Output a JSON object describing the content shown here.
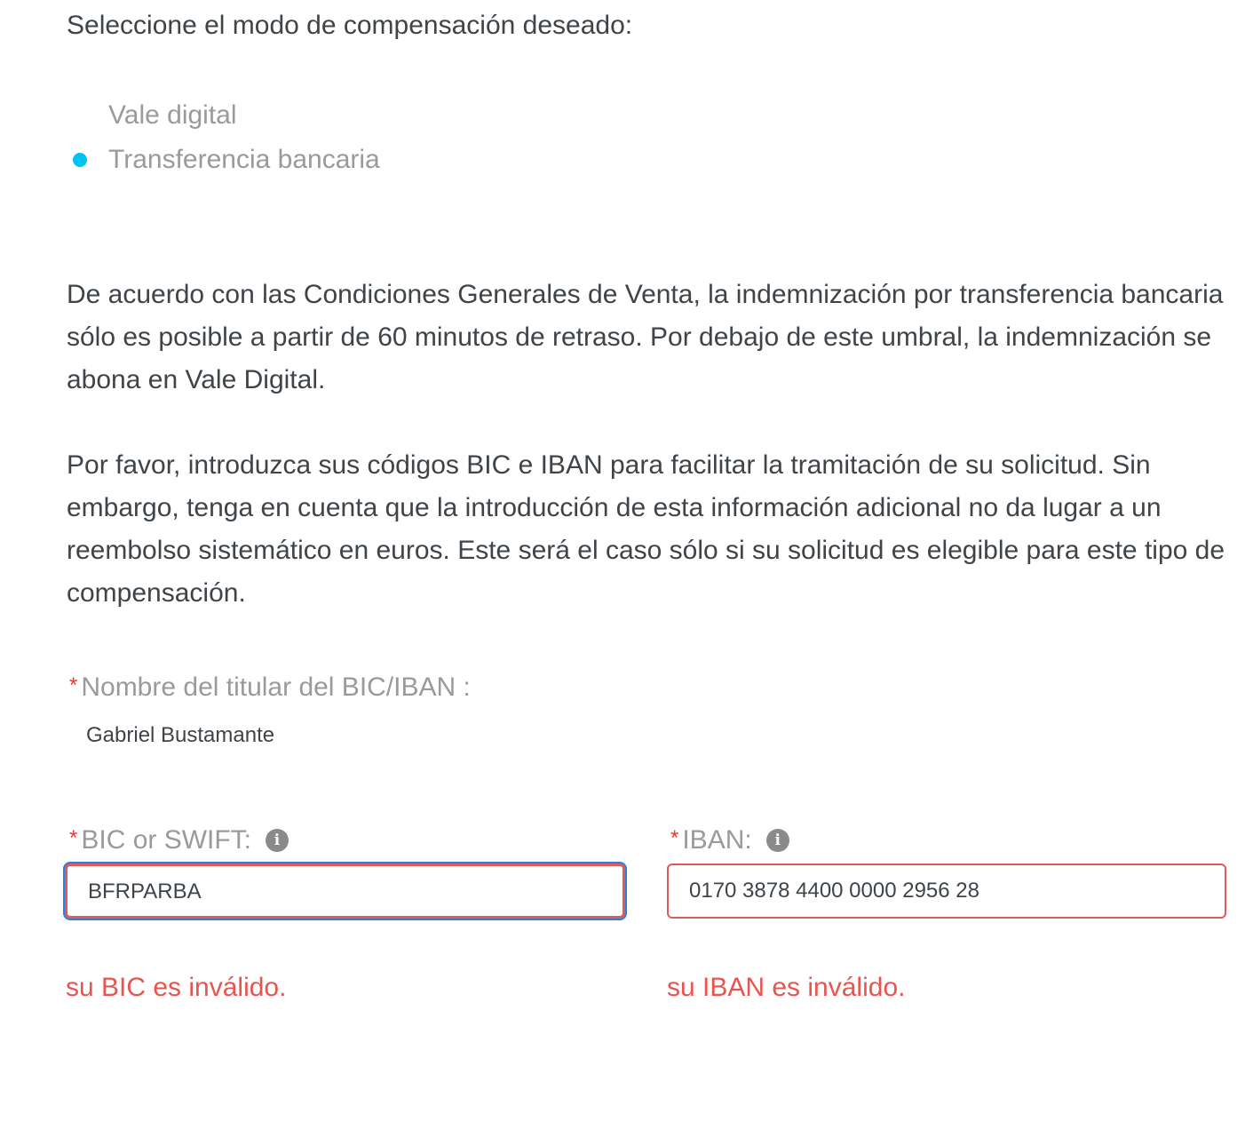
{
  "form": {
    "title": "Seleccione el modo de compensación deseado:",
    "options": [
      {
        "label": "Vale digital",
        "selected": false
      },
      {
        "label": "Transferencia bancaria",
        "selected": true
      }
    ],
    "paragraph_1": "De acuerdo con las Condiciones Generales de Venta, la indemnización por transferencia bancaria sólo es posible a partir de 60 minutos de retraso. Por debajo de este umbral, la indemnización se abona en Vale Digital.",
    "paragraph_2": "Por favor, introduzca sus códigos BIC e IBAN para facilitar la tramitación de su solicitud. Sin embargo, tenga en cuenta que la introducción de esta información adicional no da lugar a un reembolso sistemático en euros. Este será el caso sólo si su solicitud es elegible para este tipo de compensación.",
    "required_mark": "*",
    "holder": {
      "label": "Nombre del titular del BIC/IBAN :",
      "value": "Gabriel Bustamante"
    },
    "bic": {
      "label": "BIC or SWIFT:",
      "value": "BFRPARBA",
      "error": "su BIC es inválido.",
      "info_icon": "info-icon"
    },
    "iban": {
      "label": "IBAN:",
      "value": "0170 3878 4400 0000 2956 28",
      "error": "su IBAN es inválido.",
      "info_icon": "info-icon"
    }
  },
  "colors": {
    "accent_selected": "#00c3f3",
    "error": "#e8554e",
    "focus_ring": "#2f7fe0",
    "required": "#e53935"
  }
}
